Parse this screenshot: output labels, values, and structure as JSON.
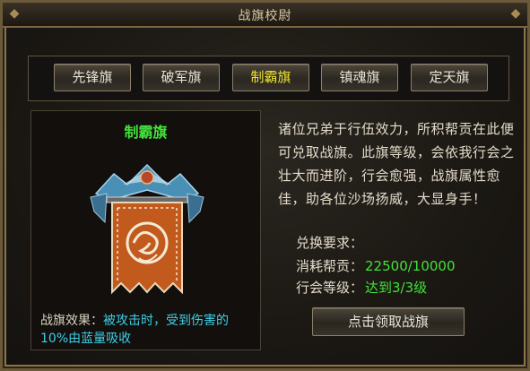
{
  "window": {
    "title": "战旗校尉"
  },
  "tabs": [
    {
      "label": "先锋旗"
    },
    {
      "label": "破军旗"
    },
    {
      "label": "制霸旗"
    },
    {
      "label": "镇魂旗"
    },
    {
      "label": "定天旗"
    }
  ],
  "active_tab": "制霸旗",
  "banner": {
    "name": "制霸旗",
    "effect_label": "战旗效果：",
    "effect_value": "被攻击时，受到伤害的10%由蓝量吸收"
  },
  "description": "诸位兄弟于行伍效力，所积帮贡在此便可兑取战旗。此旗等级，会依我行会之壮大而进阶，行会愈强，战旗属性愈佳，助各位沙场扬威，大显身手！",
  "requirements": {
    "title": "兑换要求：",
    "contribution_label": "消耗帮贡：",
    "contribution_value": "22500/10000",
    "guild_level_label": "行会等级：",
    "guild_level_value": "达到3/3级"
  },
  "claim_button": "点击领取战旗",
  "colors": {
    "active_tab": "#f0e632",
    "name": "#42e23a",
    "effect": "#3fd0e8"
  }
}
